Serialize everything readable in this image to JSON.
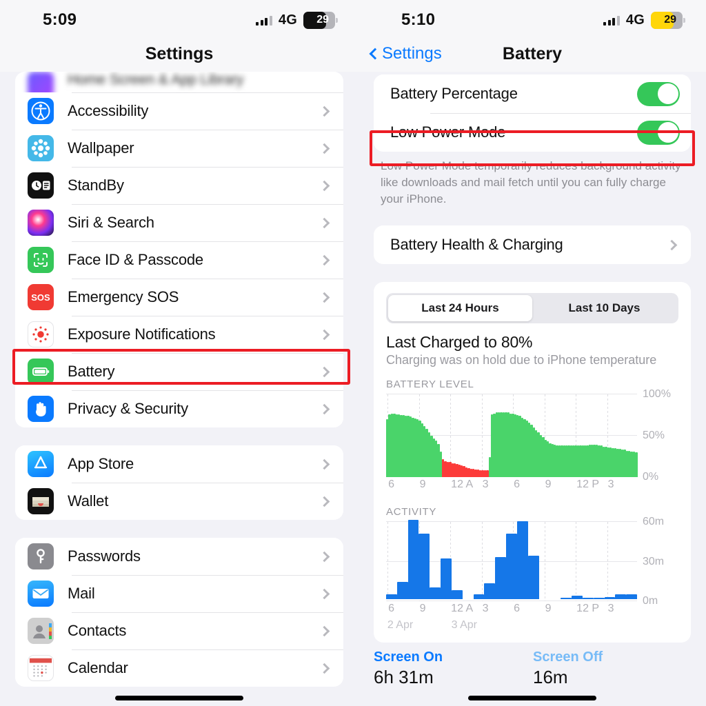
{
  "left": {
    "status": {
      "time": "5:09",
      "network": "4G",
      "battery_percent": "29",
      "battery_style": "dark"
    },
    "nav": {
      "title": "Settings"
    },
    "groups": [
      {
        "rows": [
          {
            "label": "Home Screen & App Library",
            "icon": "home-screen-icon",
            "blurred": true
          },
          {
            "label": "Accessibility",
            "icon": "accessibility-icon"
          },
          {
            "label": "Wallpaper",
            "icon": "wallpaper-icon"
          },
          {
            "label": "StandBy",
            "icon": "standby-icon"
          },
          {
            "label": "Siri & Search",
            "icon": "siri-icon"
          },
          {
            "label": "Face ID & Passcode",
            "icon": "face-id-icon"
          },
          {
            "label": "Emergency SOS",
            "icon": "sos-icon"
          },
          {
            "label": "Exposure Notifications",
            "icon": "exposure-icon"
          },
          {
            "label": "Battery",
            "icon": "battery-icon",
            "highlighted": true
          },
          {
            "label": "Privacy & Security",
            "icon": "privacy-icon"
          }
        ]
      },
      {
        "rows": [
          {
            "label": "App Store",
            "icon": "app-store-icon"
          },
          {
            "label": "Wallet",
            "icon": "wallet-icon"
          }
        ]
      },
      {
        "rows": [
          {
            "label": "Passwords",
            "icon": "passwords-icon"
          },
          {
            "label": "Mail",
            "icon": "mail-icon"
          },
          {
            "label": "Contacts",
            "icon": "contacts-icon"
          },
          {
            "label": "Calendar",
            "icon": "calendar-icon"
          }
        ]
      }
    ]
  },
  "right": {
    "status": {
      "time": "5:10",
      "network": "4G",
      "battery_percent": "29",
      "battery_style": "low"
    },
    "nav": {
      "back_label": "Settings",
      "title": "Battery"
    },
    "toggles": [
      {
        "label": "Battery Percentage",
        "on": true,
        "highlighted": false
      },
      {
        "label": "Low Power Mode",
        "on": true,
        "highlighted": true
      }
    ],
    "caption": "Low Power Mode temporarily reduces background activity like downloads and mail fetch until you can fully charge your iPhone.",
    "health_row": {
      "label": "Battery Health & Charging"
    },
    "segmented": {
      "options": [
        "Last 24 Hours",
        "Last 10 Days"
      ],
      "selected": "Last 24 Hours"
    },
    "charge_title": "Last Charged to 80%",
    "charge_sub": "Charging was on hold due to iPhone temperature",
    "stats": [
      {
        "key": "Screen On",
        "value": "6h 31m"
      },
      {
        "key": "Screen Off",
        "value": "16m"
      }
    ]
  },
  "colors": {
    "accent_blue": "#0a7aff",
    "toggle_green": "#35c759",
    "bar_green": "#4ad46a",
    "bar_red": "#fc3b39",
    "bar_blue": "#1577e8",
    "highlight_red": "#ec1c24",
    "battery_low_yellow": "#ffd60a"
  },
  "chart_data": [
    {
      "type": "bar",
      "title": "BATTERY LEVEL",
      "xlabel": "",
      "ylabel": "",
      "ylim": [
        0,
        100
      ],
      "yticks": [
        "0%",
        "50%",
        "100%"
      ],
      "xticks": [
        "6",
        "9",
        "12 A",
        "3",
        "6",
        "9",
        "12 P",
        "3"
      ],
      "day_labels": [
        "2 Apr",
        "3 Apr"
      ],
      "grid": true,
      "legend": "none",
      "series": [
        {
          "name": "Battery level",
          "colors_by_state": {
            "normal": "#4ad46a",
            "low_power": "#fc3b39"
          },
          "values": [
            70,
            76,
            77,
            77,
            76,
            76,
            75,
            75,
            74,
            74,
            73,
            72,
            71,
            70,
            68,
            65,
            62,
            58,
            54,
            50,
            47,
            44,
            40,
            31,
            22,
            19,
            18,
            18,
            17,
            17,
            16,
            15,
            14,
            13,
            12,
            11,
            10,
            10,
            9,
            9,
            8,
            8,
            8,
            8,
            24,
            76,
            77,
            78,
            78,
            78,
            78,
            78,
            78,
            77,
            77,
            76,
            75,
            74,
            72,
            70,
            68,
            66,
            63,
            60,
            57,
            54,
            51,
            48,
            45,
            43,
            41,
            40,
            39,
            38,
            38,
            38,
            38,
            38,
            38,
            38,
            38,
            38,
            38,
            38,
            38,
            38,
            38,
            39,
            39,
            39,
            39,
            38,
            38,
            37,
            37,
            36,
            36,
            35,
            35,
            34,
            34,
            33,
            33,
            32,
            32,
            31,
            31,
            30
          ],
          "states": [
            "normal",
            "normal",
            "normal",
            "normal",
            "normal",
            "normal",
            "normal",
            "normal",
            "normal",
            "normal",
            "normal",
            "normal",
            "normal",
            "normal",
            "normal",
            "normal",
            "normal",
            "normal",
            "normal",
            "normal",
            "normal",
            "normal",
            "normal",
            "normal",
            "low_power",
            "low_power",
            "low_power",
            "low_power",
            "low_power",
            "low_power",
            "low_power",
            "low_power",
            "low_power",
            "low_power",
            "low_power",
            "low_power",
            "low_power",
            "low_power",
            "low_power",
            "low_power",
            "low_power",
            "low_power",
            "low_power",
            "low_power",
            "normal",
            "normal",
            "normal",
            "normal",
            "normal",
            "normal",
            "normal",
            "normal",
            "normal",
            "normal",
            "normal",
            "normal",
            "normal",
            "normal",
            "normal",
            "normal",
            "normal",
            "normal",
            "normal",
            "normal",
            "normal",
            "normal",
            "normal",
            "normal",
            "normal",
            "normal",
            "normal",
            "normal",
            "normal",
            "normal",
            "normal",
            "normal",
            "normal",
            "normal",
            "normal",
            "normal",
            "normal",
            "normal",
            "normal",
            "normal",
            "normal",
            "normal",
            "normal",
            "normal",
            "normal",
            "normal",
            "normal",
            "normal",
            "normal",
            "normal",
            "normal",
            "normal",
            "normal",
            "normal",
            "normal",
            "normal",
            "normal",
            "normal",
            "normal",
            "normal",
            "normal",
            "normal",
            "normal",
            "normal",
            "normal",
            "normal",
            "normal",
            "normal"
          ]
        }
      ]
    },
    {
      "type": "bar",
      "title": "ACTIVITY",
      "xlabel": "",
      "ylabel": "",
      "ylim": [
        0,
        60
      ],
      "yticks": [
        "0m",
        "30m",
        "60m"
      ],
      "xticks": [
        "6",
        "9",
        "12 A",
        "3",
        "6",
        "9",
        "12 P",
        "3"
      ],
      "day_labels": [
        "2 Apr",
        "3 Apr"
      ],
      "grid": true,
      "legend": "none",
      "series": [
        {
          "name": "Screen on activity",
          "color": "#1577e8",
          "values": [
            4,
            13,
            60,
            50,
            9,
            31,
            7,
            0,
            4,
            12,
            32,
            50,
            59,
            33,
            0,
            0,
            1,
            3,
            1,
            1,
            2,
            4,
            4
          ]
        }
      ]
    }
  ]
}
